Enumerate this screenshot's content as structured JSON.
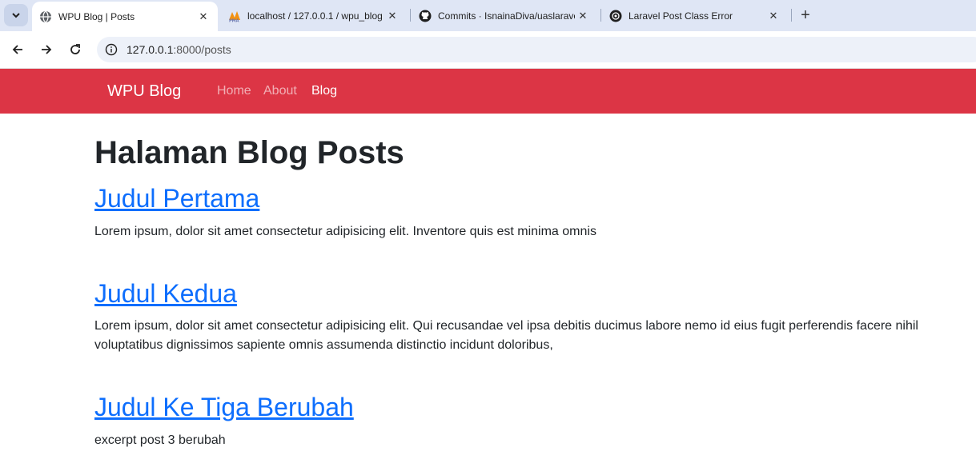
{
  "browser": {
    "tabs": [
      {
        "title": "WPU Blog | Posts",
        "active": true,
        "favicon": "globe-icon"
      },
      {
        "title": "localhost / 127.0.0.1 / wpu_blog",
        "active": false,
        "favicon": "phpmyadmin-icon"
      },
      {
        "title": "Commits · IsnainaDiva/uaslaravel",
        "active": false,
        "favicon": "github-icon"
      },
      {
        "title": "Laravel Post Class Error",
        "active": false,
        "favicon": "openai-icon"
      }
    ],
    "url_host": "127.0.0.1",
    "url_rest": ":8000/posts"
  },
  "navbar": {
    "brand": "WPU Blog",
    "links": [
      "Home",
      "About",
      "Blog"
    ],
    "active_link": "Blog",
    "bg_color": "#dc3545"
  },
  "page": {
    "heading": "Halaman Blog Posts",
    "posts": [
      {
        "title": "Judul Pertama",
        "excerpt": "Lorem ipsum, dolor sit amet consectetur adipisicing elit. Inventore quis est minima omnis"
      },
      {
        "title": "Judul Kedua",
        "excerpt": "Lorem ipsum, dolor sit amet consectetur adipisicing elit. Qui recusandae vel ipsa debitis ducimus labore nemo id eius fugit perferendis facere nihil voluptatibus dignissimos sapiente omnis assumenda distinctio incidunt doloribus,"
      },
      {
        "title": "Judul Ke Tiga Berubah",
        "excerpt": "excerpt post 3 berubah"
      }
    ]
  }
}
